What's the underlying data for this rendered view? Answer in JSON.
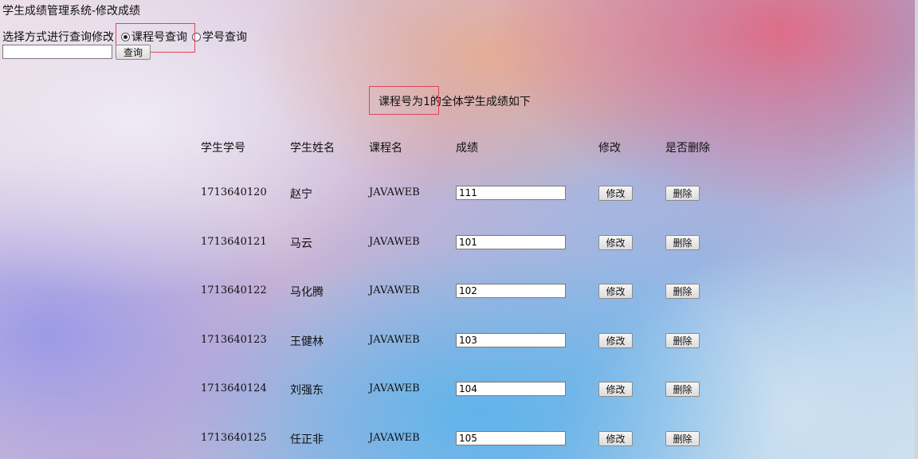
{
  "page": {
    "title": "学生成绩管理系统-修改成绩"
  },
  "query_mode": {
    "label": "选择方式进行查询修改",
    "options": [
      {
        "label": "课程号查询",
        "checked": true
      },
      {
        "label": "学号查询",
        "checked": false
      }
    ],
    "input_value": "",
    "button_label": "查询"
  },
  "result": {
    "caption": "课程号为1的全体学生成绩如下",
    "columns": [
      "学生学号",
      "学生姓名",
      "课程名",
      "成绩",
      "修改",
      "是否删除"
    ],
    "rows": [
      {
        "student_id": "1713640120",
        "name": "赵宁",
        "course": "JAVAWEB",
        "score": "111",
        "edit_label": "修改",
        "delete_label": "删除"
      },
      {
        "student_id": "1713640121",
        "name": "马云",
        "course": "JAVAWEB",
        "score": "101",
        "edit_label": "修改",
        "delete_label": "删除"
      },
      {
        "student_id": "1713640122",
        "name": "马化腾",
        "course": "JAVAWEB",
        "score": "102",
        "edit_label": "修改",
        "delete_label": "删除"
      },
      {
        "student_id": "1713640123",
        "name": "王健林",
        "course": "JAVAWEB",
        "score": "103",
        "edit_label": "修改",
        "delete_label": "删除"
      },
      {
        "student_id": "1713640124",
        "name": "刘强东",
        "course": "JAVAWEB",
        "score": "104",
        "edit_label": "修改",
        "delete_label": "删除"
      },
      {
        "student_id": "1713640125",
        "name": "任正非",
        "course": "JAVAWEB",
        "score": "105",
        "edit_label": "修改",
        "delete_label": "删除"
      }
    ]
  },
  "colors": {
    "highlight_box": "#e0455a"
  }
}
